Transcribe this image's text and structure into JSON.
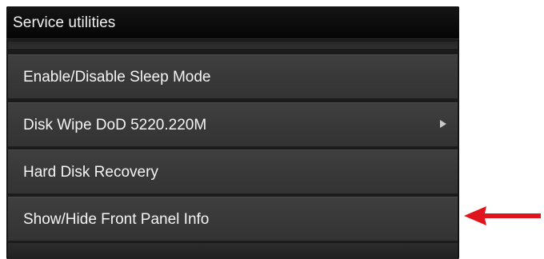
{
  "header": {
    "title": "Service utilities"
  },
  "menu": {
    "items": [
      {
        "label": "Enable/Disable Sleep Mode",
        "has_submenu": false
      },
      {
        "label": "Disk Wipe DoD 5220.220M",
        "has_submenu": true
      },
      {
        "label": "Hard Disk Recovery",
        "has_submenu": false
      },
      {
        "label": "Show/Hide Front Panel Info",
        "has_submenu": false
      }
    ]
  },
  "icons": {
    "submenu": "chevron-right-icon",
    "callout": "red-arrow-left-icon"
  },
  "colors": {
    "panel_background": "#1b1b1b",
    "item_background": "#3a3a3a",
    "text": "#f4f4f4",
    "callout_arrow": "#e0141c"
  }
}
